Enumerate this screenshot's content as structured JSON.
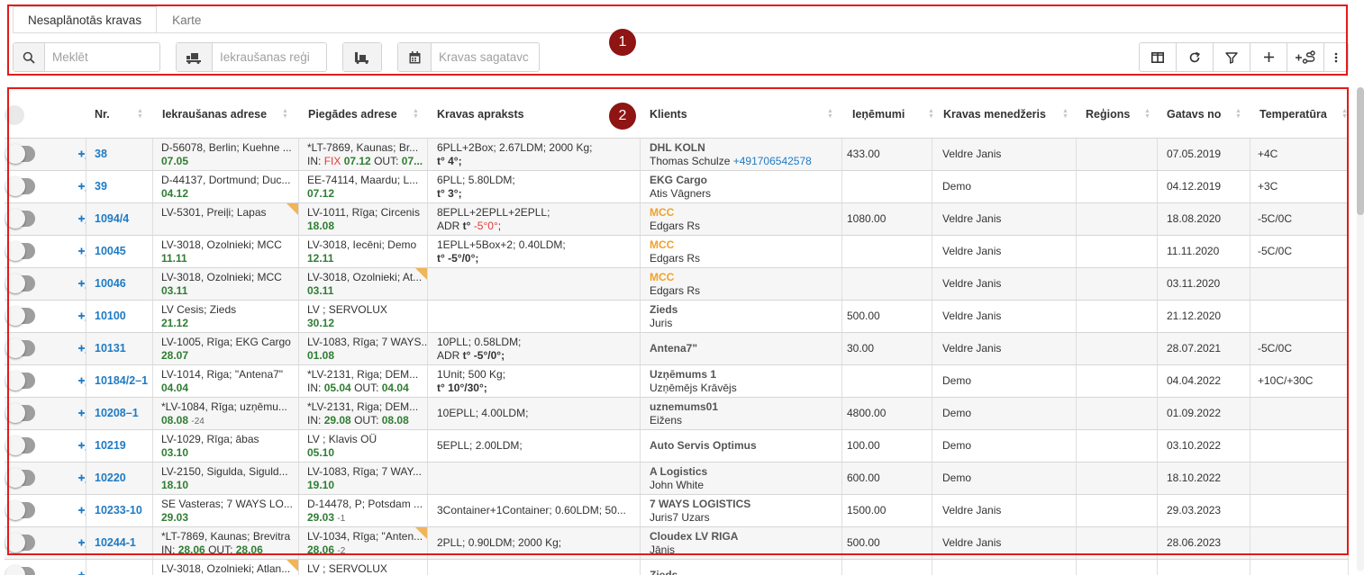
{
  "tabs": [
    {
      "label": "Nesaplānotās kravas",
      "active": true
    },
    {
      "label": "Karte",
      "active": false
    }
  ],
  "toolbar": {
    "search_placeholder": "Meklēt",
    "loading_region_placeholder": "Iekraušanas reģi",
    "ready_date_placeholder": "Kravas sagatavc"
  },
  "markers": [
    "1",
    "2"
  ],
  "columns": {
    "nr": "Nr.",
    "loading_address": "Iekraušanas adrese",
    "delivery_address": "Piegādes adrese",
    "cargo_description": "Kravas apraksts",
    "client": "Klients",
    "income": "Ieņēmumi",
    "cargo_manager": "Kravas menedžeris",
    "regions": "Reģions",
    "ready_by": "Gatavs no",
    "temperature": "Temperatūra"
  },
  "rows": [
    {
      "nr": "38",
      "load_addr": "D-56078, Berlin; Kuehne ...",
      "load_date": "07.05",
      "del_addr": "*LT-7869, Kaunas; Br...",
      "del_in": "IN:",
      "del_fix": "FIX",
      "del_in_date": "07.12",
      "del_out": "OUT:",
      "del_out_date": "07...",
      "desc1": "6PLL+2Box; 2.67LDM; 2000 Kg;",
      "desc2": "t° 4°;",
      "client": "DHL KOLN",
      "contact": "Thomas Schulze",
      "phone": "+491706542578",
      "income": "433.00",
      "manager": "Veldre Janis",
      "region": "",
      "ready": "07.05.2019",
      "temp": "+4C"
    },
    {
      "nr": "39",
      "load_addr": "D-44137, Dortmund; Duc...",
      "load_date": "04.12",
      "del_addr": "EE-74114, Maardu; L...",
      "del_date": "07.12",
      "desc1": "6PLL; 5.80LDM;",
      "desc2": "t° 3°;",
      "client": "EKG Cargo",
      "contact": "Atis Vāgners",
      "income": "",
      "manager": "Demo",
      "region": "",
      "ready": "04.12.2019",
      "temp": "+3C"
    },
    {
      "nr": "1094/4",
      "load_addr": "LV-5301, Preiļi; Lapas",
      "load_date": "",
      "del_addr": "LV-1011, Rīga; Circenis",
      "del_date": "18.08",
      "desc1": "8EPLL+2EPLL+2EPLL;",
      "desc2_prefix": "ADR ",
      "desc2": "t° ",
      "desc2_red": "-5°0°",
      "desc2_suffix": ";",
      "client": "MCC",
      "contact": "Edgars Rs",
      "income": "1080.00",
      "manager": "Veldre Janis",
      "region": "",
      "ready": "18.08.2020",
      "temp": "-5C/0C"
    },
    {
      "nr": "10045",
      "load_addr": "LV-3018, Ozolnieki; MCC",
      "load_date": "11.11",
      "del_addr": "LV-3018, Iecēni; Demo",
      "del_date": "12.11",
      "desc1": "1EPLL+5Box+2; 0.40LDM;",
      "desc2": "t° -5°/0°;",
      "client": "MCC",
      "contact": "Edgars Rs",
      "income": "",
      "manager": "Veldre Janis",
      "region": "",
      "ready": "11.11.2020",
      "temp": "-5C/0C"
    },
    {
      "nr": "10046",
      "load_addr": "LV-3018, Ozolnieki; MCC",
      "load_date": "03.11",
      "del_addr": "LV-3018, Ozolnieki; At...",
      "del_date": "03.11",
      "client": "MCC",
      "contact": "Edgars Rs",
      "income": "",
      "manager": "Veldre Janis",
      "region": "",
      "ready": "03.11.2020",
      "temp": ""
    },
    {
      "nr": "10100",
      "load_addr": "LV Cesis; Zieds",
      "load_date": "21.12",
      "del_addr": "LV ; SERVOLUX",
      "del_date": "30.12",
      "client": "Zieds",
      "contact": "Juris",
      "income": "500.00",
      "manager": "Veldre Janis",
      "region": "",
      "ready": "21.12.2020",
      "temp": ""
    },
    {
      "nr": "10131",
      "load_addr": "LV-1005, Rīga; EKG Cargo",
      "load_date": "28.07",
      "del_addr": "LV-1083, Rīga; 7 WAYS...",
      "del_date": "01.08",
      "desc1": "10PLL; 0.58LDM;",
      "desc2_prefix": "ADR ",
      "desc2": "t° -5°/0°;",
      "client": "Antena7\"",
      "contact": "",
      "income": "30.00",
      "manager": "Veldre Janis",
      "region": "",
      "ready": "28.07.2021",
      "temp": "-5C/0C"
    },
    {
      "nr": "10184/2–1",
      "load_addr": "LV-1014, Riga; \"Antena7\"",
      "load_date": "04.04",
      "del_addr": "*LV-2131, Riga; DEM...",
      "del_in": "IN:",
      "del_in_date": "05.04",
      "del_out": "OUT:",
      "del_out_date": "04.04",
      "desc1": "1Unit; 500 Kg;",
      "desc2": "t° 10°/30°;",
      "client": "Uzņēmums 1",
      "contact": "Uzņēmējs Krāvējs",
      "income": "",
      "manager": "Demo",
      "region": "",
      "ready": "04.04.2022",
      "temp": "+10C/+30C"
    },
    {
      "nr": "10208–1",
      "load_addr": "*LV-1084, Rīga; uzņēmu...",
      "load_date": "08.08",
      "load_date_small": "-24",
      "del_addr": "*LV-2131, Riga; DEM...",
      "del_in": "IN:",
      "del_in_date": "29.08",
      "del_out": "OUT:",
      "del_out_date": "08.08",
      "desc1_mid": "10EPLL; 4.00LDM;",
      "client": "uznemums01",
      "contact": "Eižens",
      "income": "4800.00",
      "manager": "Demo",
      "region": "",
      "ready": "01.09.2022",
      "temp": ""
    },
    {
      "nr": "10219",
      "load_addr": "LV-1029, Rīga; ābas",
      "load_date": "03.10",
      "del_addr": "LV ; Klavis OÜ",
      "del_date": "05.10",
      "desc1_mid": "5EPLL; 2.00LDM;",
      "client_mid": "Auto Servis Optimus",
      "income": "100.00",
      "manager": "Demo",
      "region": "",
      "ready": "03.10.2022",
      "temp": ""
    },
    {
      "nr": "10220",
      "load_addr": "LV-2150, Sigulda, Siguld...",
      "load_date": "18.10",
      "del_addr": "LV-1083, Rīga; 7 WAY...",
      "del_date": "19.10",
      "client": "A Logistics",
      "contact": "John White",
      "income": "600.00",
      "manager": "Demo",
      "region": "",
      "ready": "18.10.2022",
      "temp": ""
    },
    {
      "nr": "10233-10",
      "load_addr": "SE Vasteras; 7 WAYS LO...",
      "load_date": "29.03",
      "del_addr": "D-14478, P; Potsdam ...",
      "del_date": "29.03",
      "del_date_small": "-1",
      "desc1_mid": "3Container+1Container; 0.60LDM; 50...",
      "client": "7 WAYS LOGISTICS",
      "contact": "Juris7 Uzars",
      "income": "1500.00",
      "manager": "Veldre Janis",
      "region": "",
      "ready": "29.03.2023",
      "temp": ""
    },
    {
      "nr": "10244-1",
      "load_addr": "*LT-7869, Kaunas; Brevitra",
      "load_in": "IN:",
      "load_in_date": "28.06",
      "load_out": "OUT:",
      "load_out_date": "28.06",
      "del_addr": "LV-1034, Rīga; \"Anten...",
      "del_date": "28.06",
      "del_date_small": "-2",
      "desc1_mid": "2PLL; 0.90LDM; 2000 Kg;",
      "client": "Cloudex LV RIGA",
      "contact": "Jānis",
      "income": "500.00",
      "manager": "Veldre Janis",
      "region": "",
      "ready": "28.06.2023",
      "temp": ""
    },
    {
      "nr": "",
      "load_addr": "LV-3018, Ozolnieki; Atlan...",
      "load_date": "",
      "del_addr": "LV ; SERVOLUX",
      "del_date": "",
      "client": "Zieds",
      "contact": "",
      "income": "",
      "manager": "",
      "region": "",
      "ready": "",
      "temp": ""
    }
  ]
}
